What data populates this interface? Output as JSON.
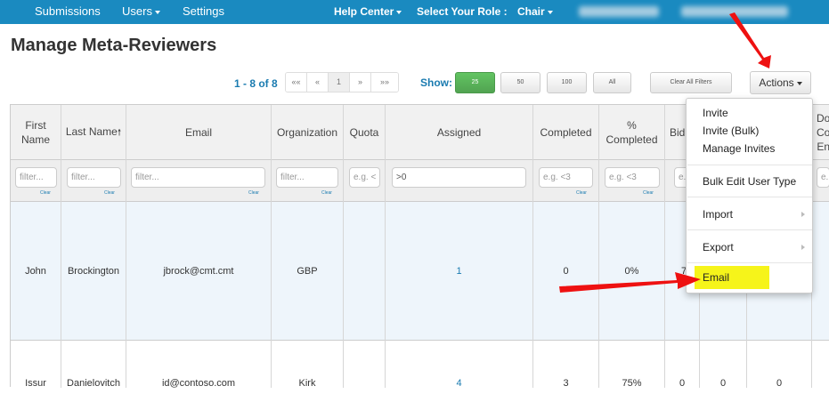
{
  "navbar": {
    "submissions": "Submissions",
    "users": "Users",
    "settings": "Settings",
    "help_center": "Help Center",
    "role_label": "Select Your Role :",
    "role_value": "Chair",
    "bg_color": "#1a8ac0"
  },
  "page": {
    "title": "Manage Meta-Reviewers"
  },
  "pagination": {
    "count": "1 - 8 of 8",
    "first": "««",
    "prev": "«",
    "current": "1",
    "next": "»",
    "last": "»»",
    "show_label": "Show:",
    "sizes": [
      "25",
      "50",
      "100",
      "All"
    ],
    "selected_size": "25",
    "clear_filters": "Clear All Filters",
    "actions": "Actions"
  },
  "table": {
    "headers": {
      "first_name": "First Name",
      "last_name": "Last Name",
      "email": "Email",
      "organization": "Organization",
      "quota": "Quota",
      "assigned": "Assigned",
      "completed": "Completed",
      "pct_completed": "% Completed",
      "bids": "Bid",
      "domain_conflicts": "Do Co En"
    },
    "filters": {
      "first_name": "filter...",
      "last_name": "filter...",
      "email": "filter...",
      "organization": "filter...",
      "quota": "e.g. <",
      "assigned": ">0",
      "completed": "e.g. <3",
      "pct_completed": "e.g. <3",
      "bids": "e.",
      "domain_conflicts": "e.",
      "clear": "Clear"
    },
    "rows": [
      {
        "first": "John",
        "last": "Brockington",
        "email": "jbrock@cmt.cmt",
        "org": "GBP",
        "quota": "",
        "assigned": "1",
        "completed": "0",
        "pct": "0%",
        "bids": "7"
      },
      {
        "first": "Issur",
        "last": "Danielovitch",
        "email": "id@contoso.com",
        "org": "Kirk",
        "quota": "",
        "assigned": "4",
        "completed": "3",
        "pct": "75%",
        "bids": "0",
        "c9": "0",
        "c10": "0"
      }
    ]
  },
  "actions_menu": {
    "items": [
      "Invite",
      "Invite (Bulk)",
      "Manage Invites",
      "Bulk Edit User Type",
      "Import",
      "Export",
      "Email"
    ],
    "highlight_color": "#f6f41a"
  },
  "annotation": {
    "arrow_color": "#ee1111"
  }
}
